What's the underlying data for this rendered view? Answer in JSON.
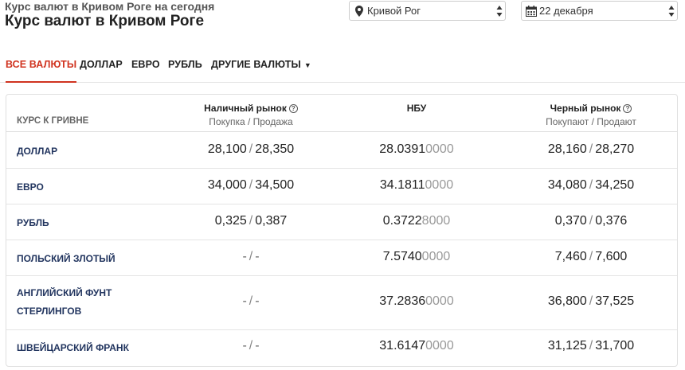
{
  "header": {
    "subtitle": "Курс валют в Кривом Роге на сегодня",
    "title": "Курс валют в Кривом Роге"
  },
  "selectors": {
    "city": {
      "value": "Кривой Рог",
      "icon": "map-pin-icon"
    },
    "date": {
      "value": "22 декабря",
      "icon": "calendar-icon"
    }
  },
  "tabs": [
    {
      "label": "ВСЕ ВАЛЮТЫ",
      "active": true
    },
    {
      "label": "ДОЛЛАР"
    },
    {
      "label": "ЕВРО"
    },
    {
      "label": "РУБЛЬ"
    },
    {
      "label": "ДРУГИЕ ВАЛЮТЫ",
      "caret": "▼"
    }
  ],
  "table": {
    "columns": {
      "currency": "КУРС К ГРИВНЕ",
      "cash": {
        "title": "Наличный рынок",
        "sub": "Покупка / Продажа"
      },
      "nbu": {
        "title": "НБУ"
      },
      "black": {
        "title": "Черный рынок",
        "sub": "Покупают / Продают"
      }
    },
    "separator": "/",
    "rows": [
      {
        "name": "ДОЛЛАР",
        "cash_buy": "28,100",
        "cash_sell": "28,350",
        "nbu_main": "28.0391",
        "nbu_tail": "0000",
        "black_buy": "28,160",
        "black_sell": "28,270"
      },
      {
        "name": "ЕВРО",
        "cash_buy": "34,000",
        "cash_sell": "34,500",
        "nbu_main": "34.1811",
        "nbu_tail": "0000",
        "black_buy": "34,080",
        "black_sell": "34,250"
      },
      {
        "name": "РУБЛЬ",
        "cash_buy": "0,325",
        "cash_sell": "0,387",
        "nbu_main": "0.3722",
        "nbu_tail": "8000",
        "black_buy": "0,370",
        "black_sell": "0,376"
      },
      {
        "name": "ПОЛЬСКИЙ ЗЛОТЫЙ",
        "cash_buy": "-",
        "cash_sell": "-",
        "nbu_main": "7.5740",
        "nbu_tail": "0000",
        "black_buy": "7,460",
        "black_sell": "7,600"
      },
      {
        "name1": "АНГЛИЙСКИЙ ФУНТ",
        "name2": "СТЕРЛИНГОВ",
        "cash_buy": "-",
        "cash_sell": "-",
        "nbu_main": "37.2836",
        "nbu_tail": "0000",
        "black_buy": "36,800",
        "black_sell": "37,525"
      },
      {
        "name": "ШВЕЙЦАРСКИЙ ФРАНК",
        "cash_buy": "-",
        "cash_sell": "-",
        "nbu_main": "31.6147",
        "nbu_tail": "0000",
        "black_buy": "31,125",
        "black_sell": "31,700"
      }
    ]
  }
}
